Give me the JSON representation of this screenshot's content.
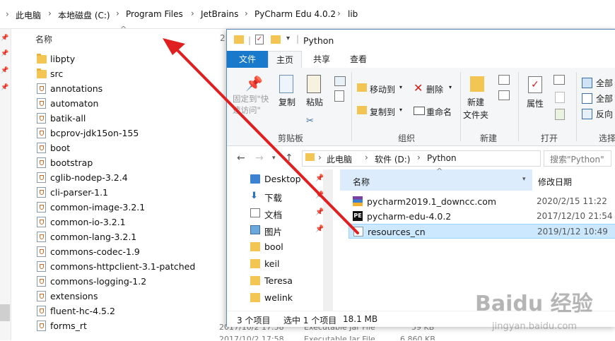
{
  "back_window": {
    "breadcrumb": [
      "此电脑",
      "本地磁盘 (C:)",
      "Program Files",
      "JetBrains",
      "PyCharm Edu 4.0.2",
      "lib"
    ],
    "column_name": "名称",
    "column_date_partial": "2",
    "files": [
      {
        "name": "libpty",
        "type": "folder"
      },
      {
        "name": "src",
        "type": "folder"
      },
      {
        "name": "annotations",
        "type": "jar"
      },
      {
        "name": "automaton",
        "type": "jar"
      },
      {
        "name": "batik-all",
        "type": "jar"
      },
      {
        "name": "bcprov-jdk15on-155",
        "type": "jar"
      },
      {
        "name": "boot",
        "type": "jar"
      },
      {
        "name": "bootstrap",
        "type": "jar"
      },
      {
        "name": "cglib-nodep-3.2.4",
        "type": "jar"
      },
      {
        "name": "cli-parser-1.1",
        "type": "jar"
      },
      {
        "name": "common-image-3.2.1",
        "type": "jar"
      },
      {
        "name": "common-io-3.2.1",
        "type": "jar"
      },
      {
        "name": "common-lang-3.2.1",
        "type": "jar"
      },
      {
        "name": "commons-codec-1.9",
        "type": "jar"
      },
      {
        "name": "commons-httpclient-3.1-patched",
        "type": "jar"
      },
      {
        "name": "commons-logging-1.2",
        "type": "jar"
      },
      {
        "name": "extensions",
        "type": "jar"
      },
      {
        "name": "fluent-hc-4.5.2",
        "type": "jar"
      },
      {
        "name": "forms_rt",
        "type": "jar"
      }
    ],
    "last_rows": [
      {
        "date": "2017/10/2 17:58",
        "type": "Executable Jar File",
        "size": "59 KB"
      },
      {
        "date": "2017/10/2 17:58",
        "type": "Executable Jar File",
        "size": "6,860 KB"
      }
    ]
  },
  "window": {
    "title": "Python",
    "tabs": [
      "文件",
      "主页",
      "共享",
      "查看"
    ],
    "ribbon": {
      "pin_quick": "固定到\"快速访问\"",
      "copy": "复制",
      "paste": "粘贴",
      "clipboard_group": "剪贴板",
      "move_to": "移动到",
      "delete": "删除",
      "copy_to": "复制到",
      "rename": "重命名",
      "organize_group": "组织",
      "new_folder": "新建\n文件夹",
      "new_folder_l1": "新建",
      "new_folder_l2": "文件夹",
      "new_group": "新建",
      "properties": "属性",
      "open_group": "打开",
      "select_all": "全部",
      "select_none": "全部",
      "invert": "反向",
      "select_group": "选择"
    },
    "address": [
      "此电脑",
      "软件 (D:)",
      "Python"
    ],
    "search_placeholder": "搜索\"Python\"",
    "nav": [
      {
        "label": "Desktop",
        "icon": "desktop",
        "pinned": true
      },
      {
        "label": "下载",
        "icon": "download",
        "pinned": true
      },
      {
        "label": "文档",
        "icon": "document",
        "pinned": true
      },
      {
        "label": "图片",
        "icon": "picture",
        "pinned": true
      },
      {
        "label": "bool",
        "icon": "folder",
        "pinned": false
      },
      {
        "label": "keil",
        "icon": "folder",
        "pinned": false
      },
      {
        "label": "Teresa",
        "icon": "folder",
        "pinned": false
      },
      {
        "label": "welink",
        "icon": "folder",
        "pinned": false
      }
    ],
    "columns": {
      "name": "名称",
      "date": "修改日期"
    },
    "files": [
      {
        "name": "pycharm2019.1_downcc.com",
        "date": "2020/2/15 11:22",
        "icon": "winrar"
      },
      {
        "name": "pycharm-edu-4.0.2",
        "date": "2017/12/10 21:54",
        "icon": "pycharm"
      },
      {
        "name": "resources_cn",
        "date": "2019/1/12 10:49",
        "icon": "jar",
        "selected": true
      }
    ],
    "status": {
      "count": "3 个项目",
      "selected": "选中 1 个项目",
      "size": "18.1 MB"
    }
  },
  "watermark": {
    "brand": "Baidu 经验",
    "url": "jingyan.baidu.com"
  },
  "colors": {
    "accent": "#1979ca",
    "selection": "#cce8ff",
    "arrow": "#e02020",
    "folder": "#f3c653"
  }
}
